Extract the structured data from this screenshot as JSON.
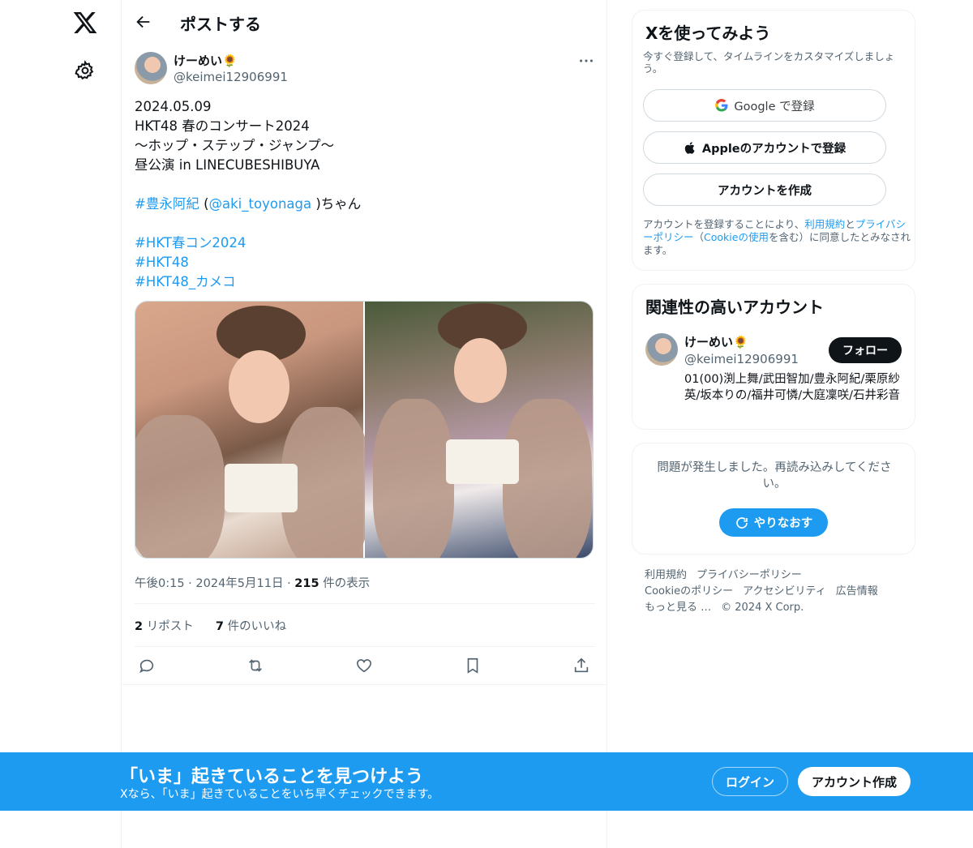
{
  "nav": {
    "logo_icon": "x-logo-icon",
    "settings_icon": "gear-icon"
  },
  "header": {
    "title": "ポストする",
    "back_icon": "arrow-left-icon"
  },
  "post": {
    "author_name": "けーめい🌻",
    "author_handle": "@keimei12906991",
    "lines": [
      "2024.05.09",
      "HKT48 春のコンサート2024",
      "〜ホップ・ステップ・ジャンプ〜",
      "昼公演 in LINECUBESHIBUYA"
    ],
    "hashtag_member": "#豊永阿紀",
    "paren_open": " (",
    "mention": "@aki_toyonaga",
    "paren_close_suffix": " )ちゃん",
    "hashtags": [
      "#HKT春コン2024",
      "#HKT48",
      "#HKT48_カメコ"
    ],
    "time": "午後0:15",
    "sep": "·",
    "date": "2024年5月11日",
    "views_count": "215",
    "views_label": "件の表示",
    "reposts_count": "2",
    "reposts_label": "リポスト",
    "likes_count": "7",
    "likes_label": "件のいいね"
  },
  "signup_card": {
    "title": "Xを使ってみよう",
    "subtitle": "今すぐ登録して、タイムラインをカスタマイズしましょう。",
    "google_label": "Google で登録",
    "apple_label": "Appleのアカウントで登録",
    "create_label": "アカウントを作成",
    "legal_prefix": "アカウントを登録することにより、",
    "legal_terms": "利用規約",
    "legal_and": "と",
    "legal_privacy": "プライバシーポリシー",
    "legal_paren_open": "（",
    "legal_cookie": "Cookieの使用",
    "legal_suffix": "を含む）に同意したとみなされます。"
  },
  "related": {
    "title": "関連性の高いアカウント",
    "name": "けーめい🌻",
    "handle": "@keimei12906991",
    "bio": "01(00)渕上舞/武田智加/豊永阿紀/栗原紗英/坂本りの/福井可憐/大庭凜咲/石井彩音",
    "follow_label": "フォロー"
  },
  "error_card": {
    "message": "問題が発生しました。再読み込みしてください。",
    "retry_label": "やりなおす"
  },
  "footer": {
    "links": [
      "利用規約",
      "プライバシーポリシー",
      "Cookieのポリシー",
      "アクセシビリティ",
      "広告情報",
      "もっと見る …"
    ],
    "copyright": "© 2024 X Corp."
  },
  "banner": {
    "title": "「いま」起きていることを見つけよう",
    "subtitle": "Xなら、「いま」起きていることをいち早くチェックできます。",
    "login_label": "ログイン",
    "signup_label": "アカウント作成"
  },
  "colors": {
    "accent": "#1d9bf0",
    "text": "#0f1419",
    "muted": "#536471"
  }
}
